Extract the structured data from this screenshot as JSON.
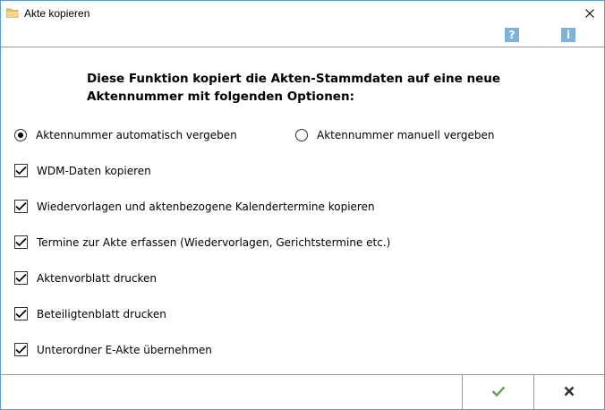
{
  "window": {
    "title": "Akte kopieren"
  },
  "toolbar": {
    "help_glyph": "?",
    "info_glyph": "i",
    "icon_color": "#7fb2d9"
  },
  "intro": {
    "line1": "Diese Funktion kopiert die Akten-Stammdaten auf eine neue",
    "line2": "Aktennummer mit folgenden Optionen:"
  },
  "radios": [
    {
      "label": "Aktennummer automatisch vergeben",
      "checked": true
    },
    {
      "label": "Aktennummer manuell vergeben",
      "checked": false
    }
  ],
  "checkboxes": [
    {
      "label": "WDM-Daten kopieren",
      "checked": true
    },
    {
      "label": "Wiedervorlagen und aktenbezogene Kalendertermine kopieren",
      "checked": true
    },
    {
      "label": "Termine zur Akte erfassen (Wiedervorlagen, Gerichtstermine etc.)",
      "checked": true
    },
    {
      "label": "Aktenvorblatt drucken",
      "checked": true
    },
    {
      "label": "Beteiligtenblatt drucken",
      "checked": true
    },
    {
      "label": "Unterordner E-Akte übernehmen",
      "checked": true
    }
  ],
  "footer": {
    "ok_icon": "check-icon",
    "cancel_icon": "x-icon",
    "ok_color": "#6a9f5a",
    "cancel_color": "#333333"
  }
}
